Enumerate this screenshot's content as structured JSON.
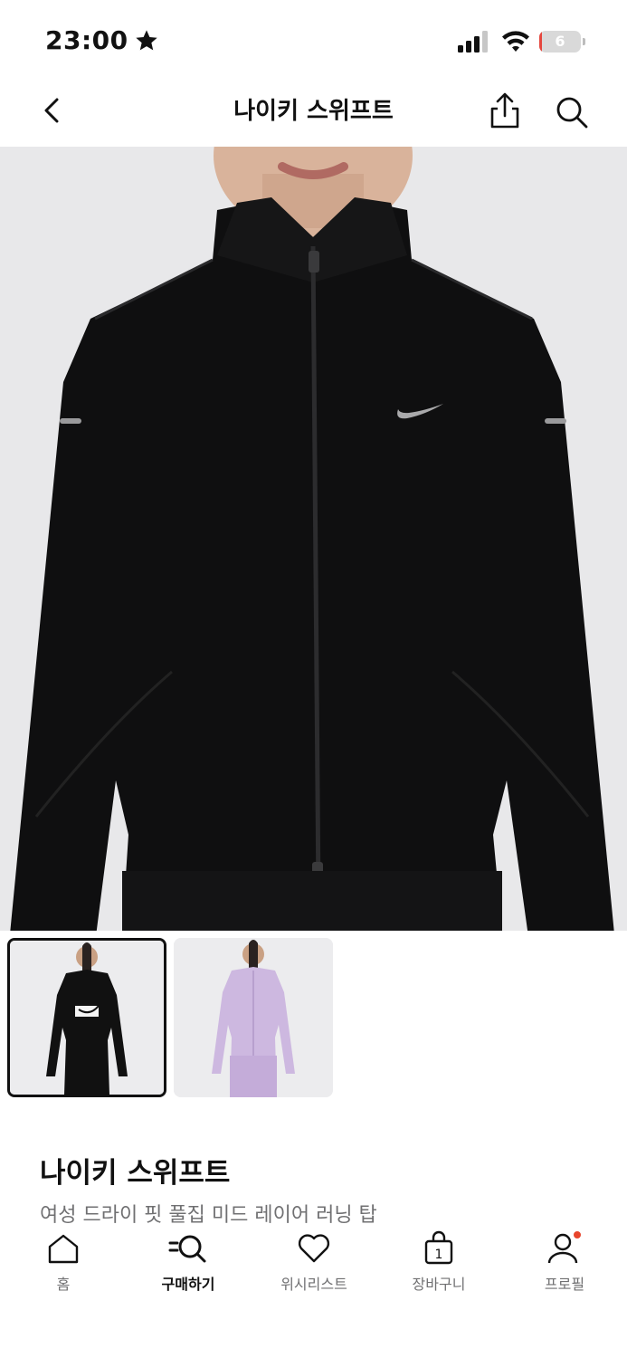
{
  "status_bar": {
    "time": "23:00",
    "battery_level": "6",
    "battery_fraction": 0.06,
    "icons": [
      "star-icon",
      "signal-icon",
      "wifi-icon",
      "battery-icon"
    ]
  },
  "header": {
    "title": "나이키 스위프트",
    "icons": [
      "back-arrow-icon",
      "share-icon",
      "search-icon"
    ]
  },
  "carousel": {
    "total_images": 8,
    "active_index": 4
  },
  "thumbnails": [
    {
      "color_name": "black"
    },
    {
      "color_name": "lavender"
    }
  ],
  "product": {
    "name": "나이키 스위프트",
    "subtitle": "여성 드라이 핏 풀집 미드 레이어 러닝 탑"
  },
  "tab_bar": {
    "items": [
      {
        "label": "홈",
        "icon": "home-icon"
      },
      {
        "label": "구매하기",
        "icon": "shop-search-icon",
        "active": true
      },
      {
        "label": "위시리스트",
        "icon": "heart-icon"
      },
      {
        "label": "장바구니",
        "icon": "bag-icon",
        "badge": "1"
      },
      {
        "label": "프로필",
        "icon": "profile-icon",
        "notification_dot": true
      }
    ]
  },
  "colors": {
    "accent": "#111111",
    "muted_text": "#707072",
    "hero_bg": "#e8e8ea",
    "notification": "#e8452c"
  }
}
